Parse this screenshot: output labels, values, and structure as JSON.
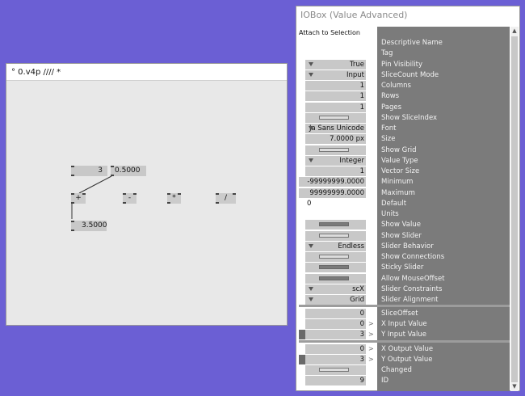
{
  "patch": {
    "title": "° 0.v4p //// *",
    "nodes": {
      "io_a": "3",
      "io_b": "0.5000",
      "op_add": "+",
      "op_sub": "-",
      "op_mul": "*",
      "op_div": "/",
      "io_result": "3.5000"
    }
  },
  "inspector": {
    "title": "IOBox (Value Advanced)",
    "attach_label": "Attach to Selection",
    "rows": [
      {
        "name": "Descriptive Name",
        "value": ""
      },
      {
        "name": "Tag",
        "value": ""
      },
      {
        "name": "Pin Visibility",
        "value": "True"
      },
      {
        "name": "SliceCount Mode",
        "value": "Input"
      },
      {
        "name": "Columns",
        "value": "1"
      },
      {
        "name": "Rows",
        "value": "1"
      },
      {
        "name": "Pages",
        "value": "1"
      },
      {
        "name": "Show SliceIndex",
        "value": ""
      },
      {
        "name": "Font",
        "value": "Ja Sans Unicode"
      },
      {
        "name": "Size",
        "value": "7.0000 px"
      },
      {
        "name": "Show Grid",
        "value": ""
      },
      {
        "name": "Value Type",
        "value": "Integer"
      },
      {
        "name": "Vector Size",
        "value": "1"
      },
      {
        "name": "Minimum",
        "value": "-99999999.0000"
      },
      {
        "name": "Maximum",
        "value": "99999999.0000"
      },
      {
        "name": "Default",
        "value": "0"
      },
      {
        "name": "Units",
        "value": ""
      },
      {
        "name": "Show Value",
        "value": ""
      },
      {
        "name": "Show Slider",
        "value": ""
      },
      {
        "name": "Slider Behavior",
        "value": "Endless"
      },
      {
        "name": "Show Connections",
        "value": ""
      },
      {
        "name": "Sticky Slider",
        "value": ""
      },
      {
        "name": "Allow MouseOffset",
        "value": ""
      },
      {
        "name": "Slider Constraints",
        "value": "scX"
      },
      {
        "name": "Slider Alignment",
        "value": "Grid"
      },
      {
        "name": "SliceOffset",
        "value": "0"
      },
      {
        "name": "X Input Value",
        "value": "0"
      },
      {
        "name": "Y Input Value",
        "value": "3"
      },
      {
        "name": "X Output Value",
        "value": "0"
      },
      {
        "name": "Y Output Value",
        "value": "3"
      },
      {
        "name": "Changed",
        "value": ""
      },
      {
        "name": "ID",
        "value": "9"
      }
    ]
  },
  "icons": {
    "pin_arrow": ">",
    "scroll_up": "▲",
    "scroll_down": "▼"
  },
  "colors": {
    "desktop": "#6b5fd4",
    "patch_bg": "#e8e8e8",
    "inspector_names_bg": "#7b7b7b",
    "node_fill": "#c8c8c8"
  }
}
